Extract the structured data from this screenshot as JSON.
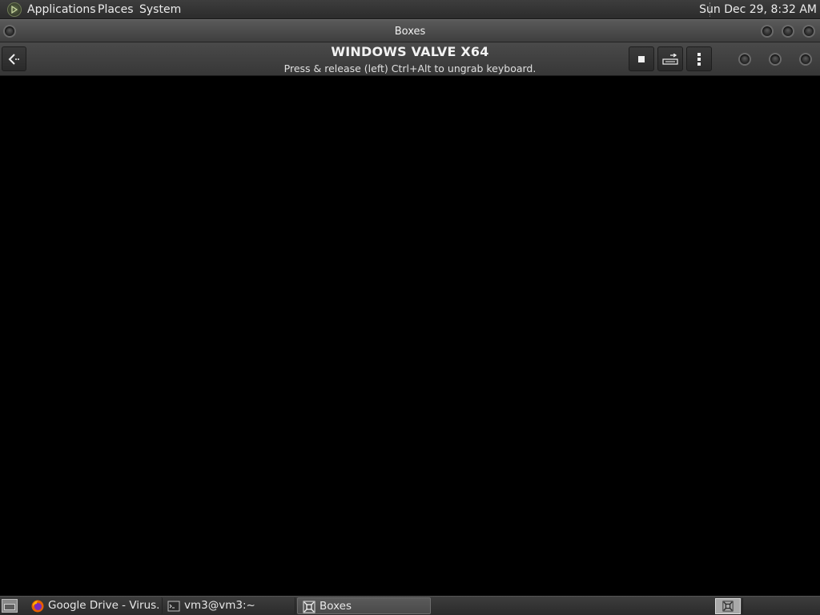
{
  "top_panel": {
    "menus": [
      "Applications",
      "Places",
      "System"
    ],
    "clock": "Sun Dec 29,  8:32 AM"
  },
  "window": {
    "title": "Boxes"
  },
  "header": {
    "vm_name": "WINDOWS VALVE X64",
    "hint": "Press & release (left) Ctrl+Alt to ungrab keyboard."
  },
  "taskbar": {
    "tasks": [
      {
        "label": "Google Drive - Virus...",
        "icon": "firefox-icon",
        "active": false
      },
      {
        "label": "vm3@vm3:~",
        "icon": "terminal-icon",
        "active": false
      },
      {
        "label": "Boxes",
        "icon": "boxes-icon",
        "active": true
      }
    ]
  },
  "colors": {
    "panel_bg": "#333333",
    "vm_display_bg": "#000000",
    "text": "#ececec"
  }
}
